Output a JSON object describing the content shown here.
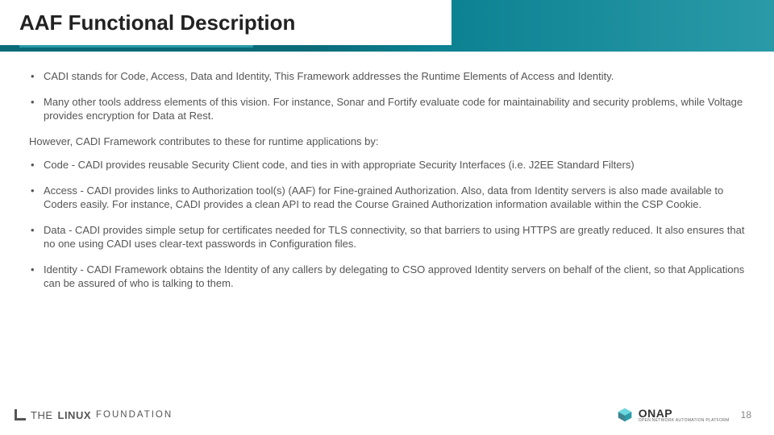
{
  "title": "AAF Functional Description",
  "bullets_top": [
    "CADI stands for Code, Access, Data and Identity, This Framework addresses the Runtime Elements of Access and Identity.",
    "Many other tools address elements of this vision.  For instance, Sonar and Fortify evaluate code for maintainability and security problems, while Voltage provides encryption for Data at Rest."
  ],
  "intro": "However, CADI Framework contributes to these for runtime applications by:",
  "bullets_bottom": [
    "Code - CADI provides reusable Security Client code, and ties in with appropriate Security Interfaces (i.e. J2EE Standard Filters)",
    "Access - CADI provides links to Authorization tool(s) (AAF) for Fine-grained Authorization. Also, data from Identity servers is also made available to Coders easily. For instance, CADI provides a clean API to read the Course Grained Authorization information available within the CSP Cookie.",
    "Data - CADI provides simple setup for certificates needed for TLS connectivity, so that barriers to using HTTPS are greatly reduced. It also ensures that no one using CADI uses clear-text passwords in Configuration files.",
    "Identity - CADI Framework obtains the Identity of any callers by delegating to CSO approved Identity servers on behalf of the client, so that Applications can be assured of who is talking to them."
  ],
  "footer": {
    "lf1": "THE",
    "lf2": "LINUX",
    "lf3": "FOUNDATION",
    "onap_big": "ONAP",
    "onap_small": "OPEN NETWORK AUTOMATION PLATFORM",
    "page": "18"
  }
}
